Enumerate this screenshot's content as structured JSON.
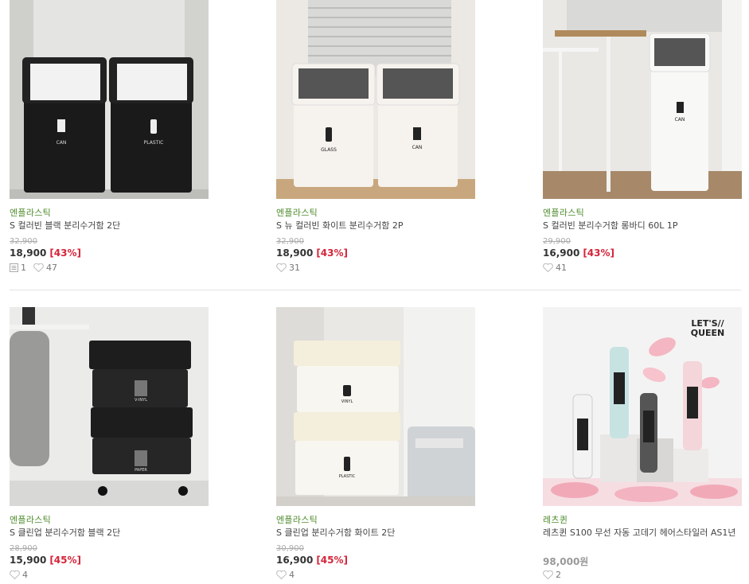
{
  "products": [
    {
      "brand": "엔플라스틱",
      "name": "S 컬러빈 블랙 분리수거함 2단",
      "orig_price": "32,900",
      "price": "18,900",
      "discount": "[43%]",
      "reviews": "1",
      "likes": "47"
    },
    {
      "brand": "엔플라스틱",
      "name": "S 뉴 컬러빈 화이트 분리수거함 2P",
      "orig_price": "32,900",
      "price": "18,900",
      "discount": "[43%]",
      "likes": "31"
    },
    {
      "brand": "엔플라스틱",
      "name": "S 컬러빈 분리수거함 롱바디 60L 1P",
      "orig_price": "29,900",
      "price": "16,900",
      "discount": "[43%]",
      "likes": "41"
    },
    {
      "brand": "엔플라스틱",
      "name": "S 클린업 분리수거함 블랙 2단",
      "orig_price": "28,900",
      "price": "15,900",
      "discount": "[45%]",
      "likes": "4"
    },
    {
      "brand": "엔플라스틱",
      "name": "S 클린업 분리수거함 화이트 2단",
      "orig_price": "30,900",
      "price": "16,900",
      "discount": "[45%]",
      "likes": "4"
    },
    {
      "brand": "레츠퀸",
      "name": "레츠퀸 S100 무선 자동 고데기 헤어스타일러 AS1년",
      "price": "98,000원",
      "likes": "2"
    }
  ],
  "image_labels": {
    "can": "CAN",
    "plastic": "PLASTIC",
    "glass": "GLASS",
    "vinyl_caps": "V-INYL",
    "paper": "PAPER",
    "vinyl": "VINYL",
    "brand_logo_line1": "LET'S//",
    "brand_logo_line2": "QUEEN"
  },
  "colors": {
    "brand_green": "#4c8a2a",
    "discount_red": "#d4253a"
  },
  "icons": {
    "review": "review-icon",
    "like": "heart-icon"
  }
}
